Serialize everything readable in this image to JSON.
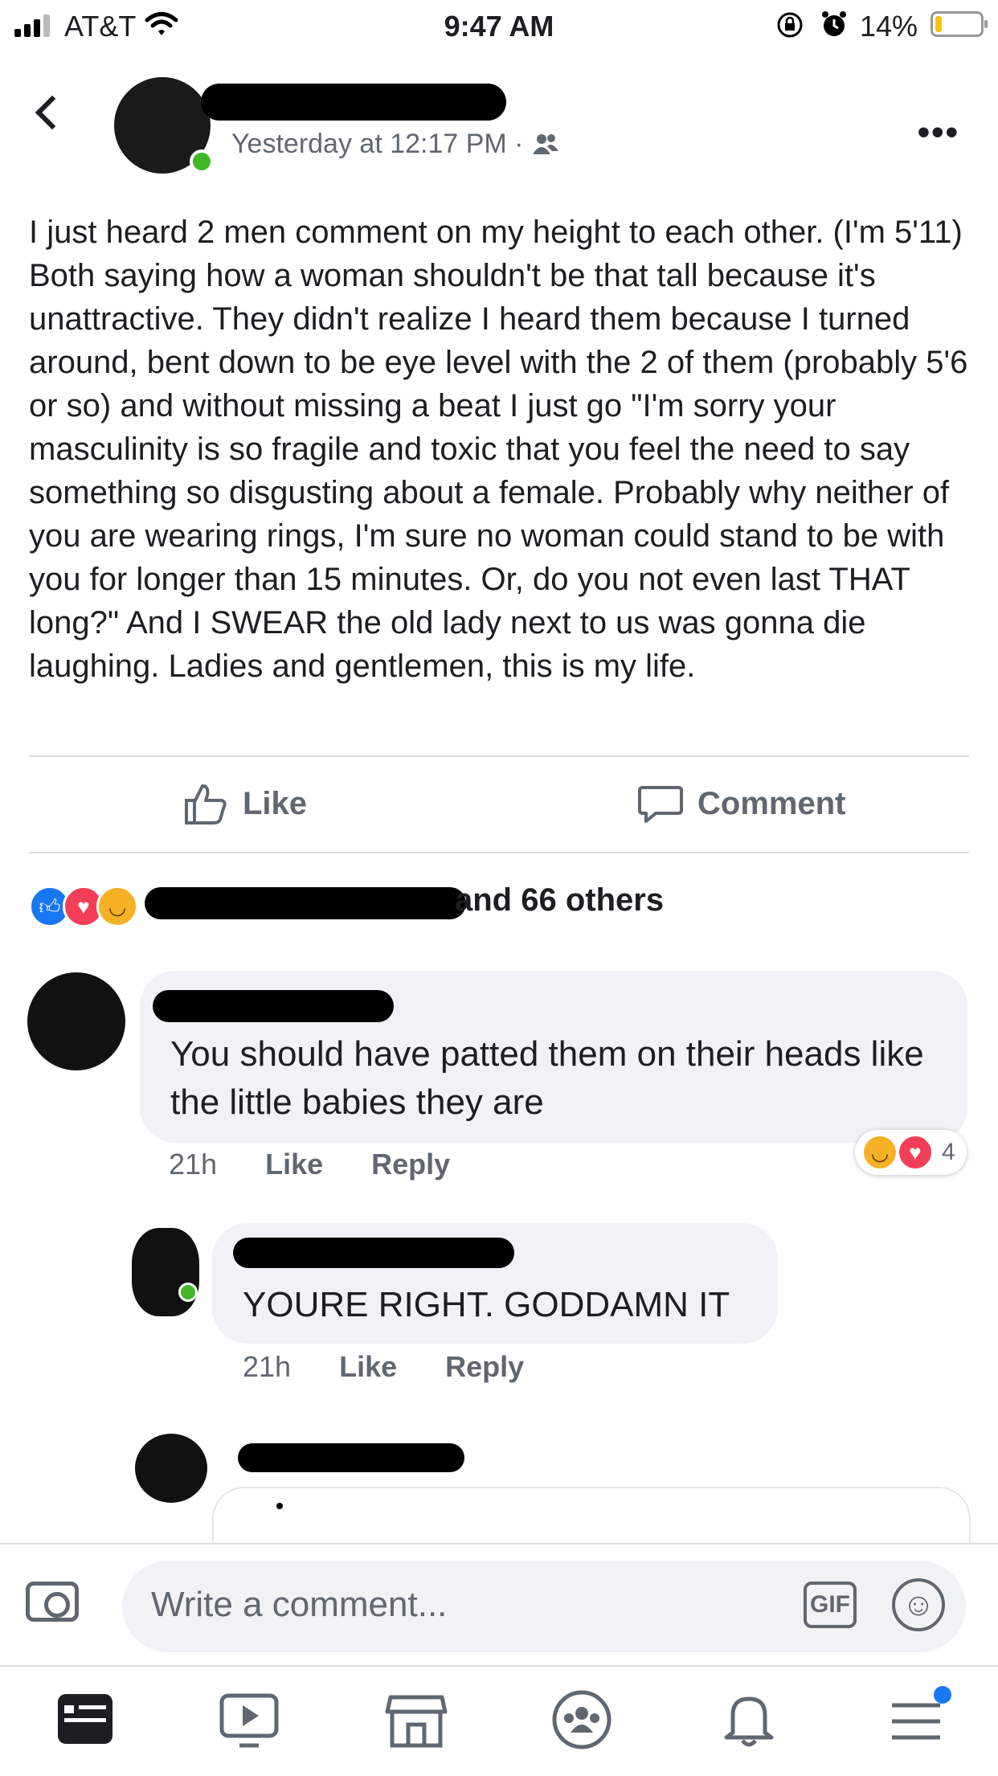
{
  "status_bar": {
    "carrier": "AT&T",
    "time": "9:47 AM",
    "battery_percent": "14%",
    "battery_level": 0.14,
    "icons": [
      "signal-icon",
      "wifi-icon",
      "rotation-lock-icon",
      "alarm-icon",
      "battery-icon"
    ]
  },
  "post": {
    "timestamp": "Yesterday at 12:17 PM · ",
    "audience_icon": "friends-icon",
    "body": "I just heard 2 men comment on my height to each other. (I'm 5'11) Both saying how a woman shouldn't be that tall because it's unattractive. They didn't realize I heard them because I turned around, bent down to be eye level with the 2 of them (probably 5'6 or so) and without missing a beat I just go \"I'm sorry your masculinity is so fragile and toxic that you feel the need to say something so disgusting about a female. Probably why neither of you are wearing rings, I'm sure no woman could stand to be with you for longer than 15 minutes. Or, do you not even last THAT long?\" And I SWEAR the old lady next to us was gonna die laughing. Ladies and gentlemen, this is my life."
  },
  "actions": {
    "like_label": "Like",
    "comment_label": "Comment"
  },
  "reactions_summary": {
    "text": "and 66 others",
    "types": [
      "like",
      "love",
      "haha"
    ]
  },
  "comments": [
    {
      "text": "You should have patted them on their heads like the little babies they are",
      "time": "21h",
      "like_label": "Like",
      "reply_label": "Reply",
      "reaction_count": "4",
      "reaction_types": [
        "haha",
        "love"
      ]
    },
    {
      "text": "YOURE RIGHT. GODDAMN IT",
      "time": "21h",
      "like_label": "Like",
      "reply_label": "Reply"
    }
  ],
  "composer": {
    "placeholder": "Write a comment...",
    "gif_label": "GIF"
  },
  "tab_bar": {
    "items": [
      "news-feed-icon",
      "watch-icon",
      "marketplace-icon",
      "groups-icon",
      "notifications-icon",
      "menu-icon"
    ],
    "active": "news-feed-icon"
  },
  "colors": {
    "facebook_blue": "#1877f2",
    "love_red": "#f33e58",
    "haha_yellow": "#f7b125",
    "bubble_gray": "#f0f2f5",
    "meta_gray": "#606770"
  }
}
